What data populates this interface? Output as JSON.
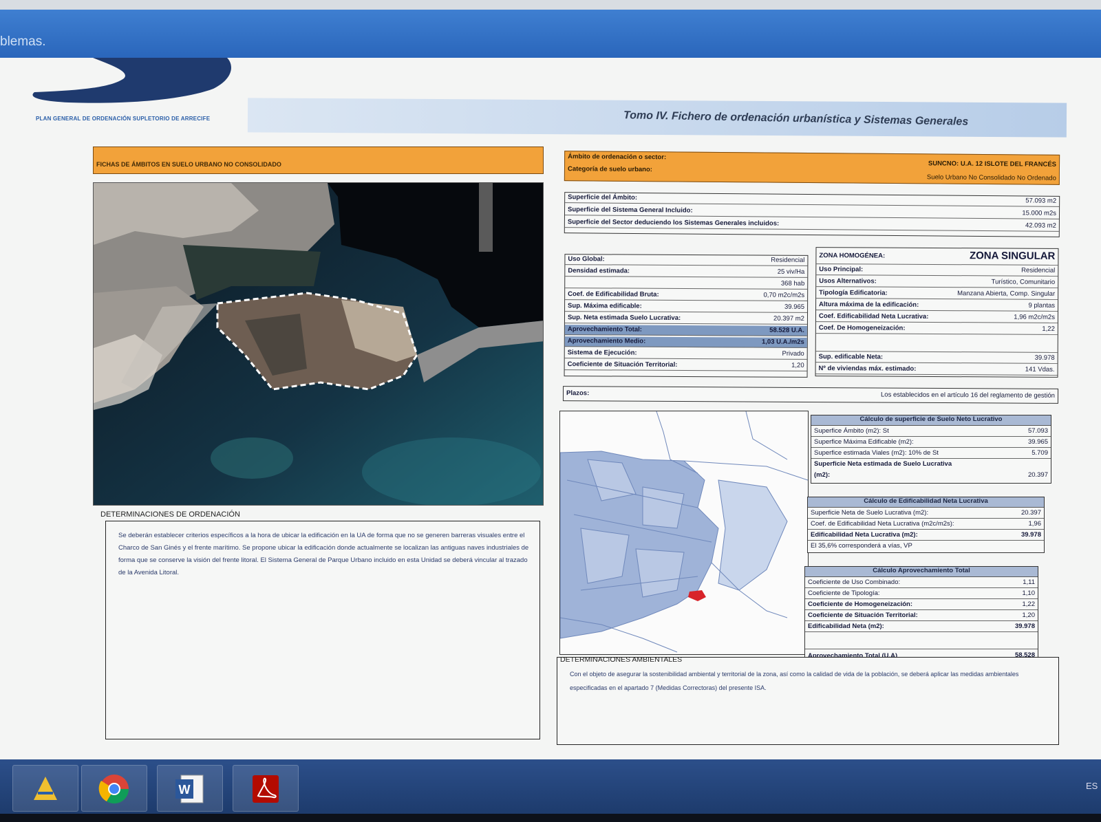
{
  "window": {
    "title_fragment": "blemas."
  },
  "document": {
    "logo_text": "PLAN GENERAL DE ORDENACIÓN SUPLETORIO DE ARRECIFE",
    "tomo_title": "Tomo IV. Fichero de ordenación urbanística y Sistemas Generales",
    "fichas_header": "FICHAS DE ÁMBITOS EN SUELO URBANO NO CONSOLIDADO",
    "ambito_label": "Ámbito de ordenación o sector:",
    "ambito_value": "SUNCNO: U.A. 12 ISLOTE DEL FRANCÉS",
    "categoria_label": "Categoría de suelo urbano:",
    "categoria_value": "Suelo Urbano No Consolidado No Ordenado",
    "superficies": [
      {
        "label": "Superficie del Ámbito:",
        "value": "57.093 m2"
      },
      {
        "label": "Superficie del Sistema General Incluido:",
        "value": "15.000 m2s"
      },
      {
        "label": "Superficie del Sector deduciendo los Sistemas Generales incluidos:",
        "value": "42.093 m2"
      }
    ],
    "uso": [
      {
        "label": "Uso Global:",
        "value": "Residencial",
        "hl": false
      },
      {
        "label": "Densidad estimada:",
        "value": "25 viv/Ha",
        "hl": false
      },
      {
        "label": "",
        "value": "368 hab",
        "hl": false
      },
      {
        "label": "Coef. de Edificabilidad Bruta:",
        "value": "0,70 m2c/m2s",
        "hl": false
      },
      {
        "label": "Sup. Máxima edificable:",
        "value": "39.965",
        "hl": false
      },
      {
        "label": "Sup. Neta estimada Suelo Lucrativa:",
        "value": "20.397 m2",
        "hl": false
      },
      {
        "label": "Aprovechamiento Total:",
        "value": "58.528 U.A.",
        "hl": true
      },
      {
        "label": "Aprovechamiento Medio:",
        "value": "1,03 U.A./m2s",
        "hl": true
      },
      {
        "label": "Sistema de Ejecución:",
        "value": "Privado",
        "hl": false
      },
      {
        "label": "Coeficiente de Situación Territorial:",
        "value": "1,20",
        "hl": false
      }
    ],
    "zona": {
      "label": "ZONA HOMOGÉNEA:",
      "value": "ZONA SINGULAR",
      "rows": [
        {
          "label": "Uso Principal:",
          "value": "Residencial"
        },
        {
          "label": "Usos Alternativos:",
          "value": "Turístico, Comunitario"
        },
        {
          "label": "Tipología Edificatoria:",
          "value": "Manzana Abierta, Comp. Singular"
        },
        {
          "label": "Altura máxima de la edificación:",
          "value": "9 plantas"
        },
        {
          "label": "Coef. Edificabilidad Neta Lucrativa:",
          "value": "1,96 m2c/m2s"
        },
        {
          "label": "Coef. De Homogeneización:",
          "value": "1,22"
        },
        {
          "label": "",
          "value": ""
        },
        {
          "label": "Sup. edificable Neta:",
          "value": "39.978"
        },
        {
          "label": "Nº de viviendas máx. estimado:",
          "value": "141 Vdas."
        }
      ]
    },
    "plazos": {
      "label": "Plazos:",
      "value": "Los establecidos en el artículo 16 del reglamento de gestión"
    },
    "calc_superficie": {
      "title": "Cálculo de superficie de Suelo Neto Lucrativo",
      "rows": [
        {
          "label": "Superfice Ámbito (m2): St",
          "value": "57.093"
        },
        {
          "label": "Superfice Máxima Edificable (m2):",
          "value": "39.965"
        },
        {
          "label": "Superfice estimada Viales (m2): 10% de St",
          "value": "5.709"
        },
        {
          "label": "Superficie Neta estimada de Suelo Lucrativa",
          "value": ""
        },
        {
          "label": "(m2):",
          "value": "20.397"
        }
      ]
    },
    "calc_edificabilidad": {
      "title": "Cálculo de Edificabilidad Neta Lucrativa",
      "rows": [
        {
          "label": "Superficie Neta de Suelo Lucrativa (m2):",
          "value": "20.397"
        },
        {
          "label": "Coef. de Edificabilidad Neta Lucrativa (m2c/m2s):",
          "value": "1,96"
        },
        {
          "label": "Edificabilidad Neta Lucrativa (m2):",
          "value": "39.978"
        },
        {
          "label": "El 35,6% corresponderá a vías, VP",
          "value": ""
        }
      ]
    },
    "calc_aprovechamiento": {
      "title": "Cálculo Aprovechamiento Total",
      "rows": [
        {
          "label": "Coeficiente de Uso Combinado:",
          "value": "1,11"
        },
        {
          "label": "Coeficiente de Tipología:",
          "value": "1,10"
        },
        {
          "label": "Coeficiente de Homogeneización:",
          "value": "1,22"
        },
        {
          "label": "Coeficiente de Situación Territorial:",
          "value": "1,20"
        },
        {
          "label": "Edificabilidad Neta (m2):",
          "value": "39.978"
        },
        {
          "label": "",
          "value": ""
        },
        {
          "label": "Aprovechamiento Total (U.A)",
          "value": "58.528"
        }
      ]
    },
    "det_ordenacion": {
      "label": "DETERMINACIONES DE ORDENACIÓN",
      "text": "Se deberán establecer criterios específicos a la hora de ubicar la edificación en la UA de forma que no se generen barreras visuales entre el Charco de San Ginés y el frente marítimo. Se propone ubicar la edificación donde actualmente se localizan las antiguas naves industriales de forma que se conserve la visión del frente litoral. El Sistema General de Parque Urbano incluido en esta Unidad se deberá vincular al trazado de la Avenida Litoral."
    },
    "det_ambientales": {
      "label": "DETERMINACIONES AMBIENTALES",
      "text": "Con el objeto de asegurar la sostenibilidad ambiental y territorial de la zona, así como la calidad de vida de la población, se deberá aplicar las medidas ambientales especificadas en el apartado 7 (Medidas Correctoras) del presente ISA."
    }
  },
  "taskbar": {
    "apps": [
      {
        "name": "Arquímedes",
        "icon": "app-icon"
      },
      {
        "name": "Google Chrome",
        "icon": "chrome-icon"
      },
      {
        "name": "Microsoft Word",
        "icon": "word-icon"
      },
      {
        "name": "Adobe Reader",
        "icon": "pdf-icon"
      }
    ],
    "tray": "ES"
  },
  "colors": {
    "header_orange": "#f2a23a",
    "highlight_blue": "#7e99c0",
    "titlebar_blue": "#2a66bb",
    "taskbar_blue": "#1b3868",
    "plan_area_red": "#d8232a"
  }
}
